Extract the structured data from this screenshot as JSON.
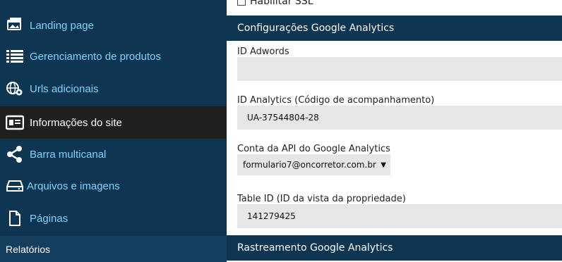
{
  "sidebar": {
    "items": [
      {
        "label": "Landing page",
        "icon": "landing-page-icon"
      },
      {
        "label": "Gerenciamento de produtos",
        "icon": "list-icon"
      },
      {
        "label": "Urls adicionais",
        "icon": "globe-gear-icon"
      },
      {
        "label": "Informações do site",
        "icon": "id-card-icon"
      },
      {
        "label": "Barra multicanal",
        "icon": "share-icon"
      },
      {
        "label": "Arquivos e imagens",
        "icon": "drive-icon"
      },
      {
        "label": "Páginas",
        "icon": "page-icon"
      }
    ],
    "active_index": 3,
    "footer_label": "Relatórios"
  },
  "main": {
    "ssl_label": "Habilitar SSL",
    "ssl_checked": false,
    "ga_section_title": "Configurações Google Analytics",
    "adwords_label": "ID Adwords",
    "adwords_value": "",
    "analytics_label": "ID Analytics (Código de acompanhamento)",
    "analytics_value": "UA-37544804-28",
    "api_account_label": "Conta da API do Google Analytics",
    "api_account_value": "formulario7@oncorretor.com.br",
    "table_id_label": "Table ID (ID da vista da propriedade)",
    "table_id_value": "141279425",
    "tracking_section_title": "Rastreamento Google Analytics"
  },
  "colors": {
    "sidebar_bg": "#0e3552",
    "active_bg": "#221f1f",
    "link_text": "#7fd3ff",
    "input_bg": "#e6e6e6"
  }
}
